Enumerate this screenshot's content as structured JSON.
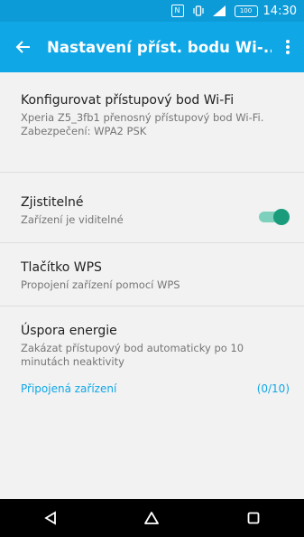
{
  "status_bar": {
    "time": "14:30",
    "battery": "100",
    "icons": [
      "nfc-icon",
      "vibrate-icon",
      "signal-icon",
      "battery-icon"
    ]
  },
  "app_bar": {
    "title": "Nastavení příst. bodu Wi-...",
    "back_icon": "arrow-left-icon",
    "menu_icon": "more-vertical-icon",
    "background": "#10a7e6"
  },
  "settings": {
    "items": [
      {
        "title": "Konfigurovat přístupový bod Wi-Fi",
        "subtitle": "Xperia Z5_3fb1 přenosný přístupový bod Wi-Fi.",
        "extra": "Zabezpečení: WPA2 PSK"
      },
      {
        "title": "Zjistitelné",
        "subtitle": "Zařízení je viditelné",
        "toggle_on": true
      },
      {
        "title": "Tlačítko WPS",
        "subtitle": "Propojení zařízení pomocí WPS"
      },
      {
        "title": "Úspora energie",
        "subtitle": "Zakázat přístupový bod automaticky po 10 minutách neaktivity"
      }
    ],
    "connected_label": "Připojená zařízení",
    "connected_count": "(0/10)"
  },
  "nav_bar": {
    "icons": [
      "back-triangle-icon",
      "home-icon",
      "recents-icon"
    ]
  }
}
